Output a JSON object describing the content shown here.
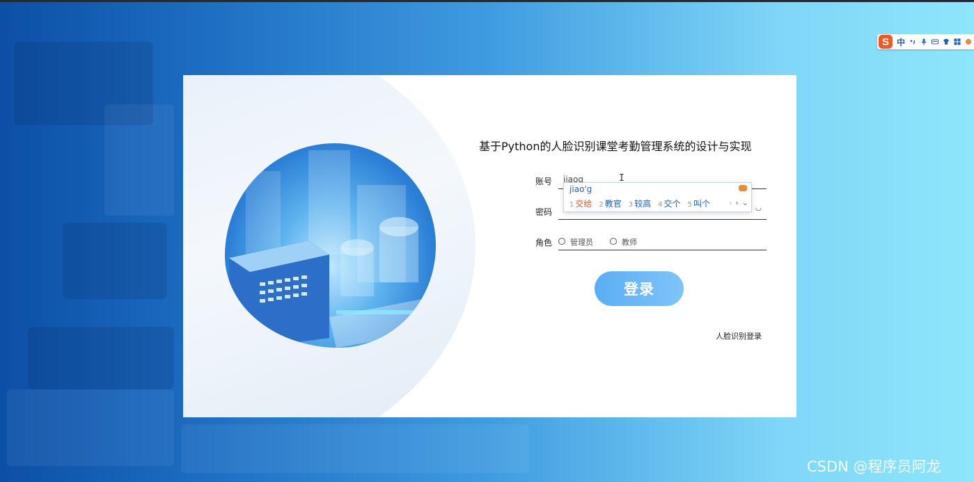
{
  "system_title": "基于Python的人脸识别课堂考勤管理系统的设计与实现",
  "form": {
    "account_label": "账号",
    "account_value": "jiaog",
    "password_label": "密码",
    "role_label": "角色",
    "roles": [
      "管理员",
      "教师"
    ],
    "login_button": "登录",
    "face_login_link": "人脸识别登录"
  },
  "ime": {
    "status_logo": "S",
    "status_mode": "中",
    "pinyin": "jiao'g",
    "candidates": [
      {
        "num": "1",
        "text": "交给"
      },
      {
        "num": "2",
        "text": "教官"
      },
      {
        "num": "3",
        "text": "较高"
      },
      {
        "num": "4",
        "text": "交个"
      },
      {
        "num": "5",
        "text": "叫个"
      }
    ],
    "nav_prev": "‹",
    "nav_next": "›",
    "nav_more": "⌄"
  },
  "watermark": "CSDN @程序员阿龙"
}
